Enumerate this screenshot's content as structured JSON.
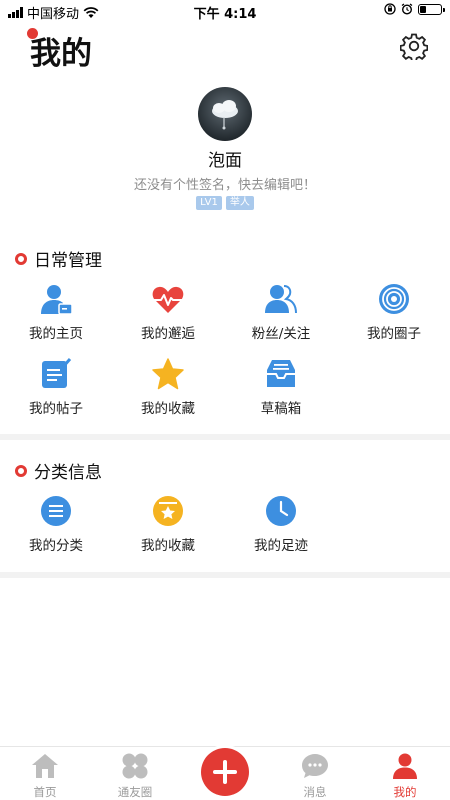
{
  "status_bar": {
    "carrier": "中国移动",
    "time": "下午 4:14"
  },
  "header": {
    "title": "我的"
  },
  "profile": {
    "username": "泡面",
    "signature": "还没有个性签名，快去编辑吧！",
    "level_badge": "LV1",
    "role_badge": "举人"
  },
  "daily": {
    "title": "日常管理",
    "items": [
      {
        "label": "我的主页",
        "icon": "user-card-icon"
      },
      {
        "label": "我的邂逅",
        "icon": "heartbeat-icon"
      },
      {
        "label": "粉丝/关注",
        "icon": "users-icon"
      },
      {
        "label": "我的圈子",
        "icon": "target-icon"
      },
      {
        "label": "我的帖子",
        "icon": "edit-doc-icon"
      },
      {
        "label": "我的收藏",
        "icon": "star-icon"
      },
      {
        "label": "草稿箱",
        "icon": "inbox-tray-icon"
      }
    ]
  },
  "category": {
    "title": "分类信息",
    "items": [
      {
        "label": "我的分类",
        "icon": "list-circle-icon"
      },
      {
        "label": "我的收藏",
        "icon": "star-box-icon"
      },
      {
        "label": "我的足迹",
        "icon": "clock-icon"
      }
    ]
  },
  "tabbar": {
    "items": [
      {
        "label": "首页",
        "icon": "home-icon"
      },
      {
        "label": "通友圈",
        "icon": "clover-icon"
      },
      {
        "label": "消息",
        "icon": "message-icon"
      },
      {
        "label": "我的",
        "icon": "person-icon",
        "active": true
      }
    ]
  },
  "colors": {
    "accent": "#e23a34",
    "icon_blue": "#3d8fe0",
    "icon_red": "#e8443d",
    "icon_yellow": "#f5b321",
    "badge": "#a9c9ec"
  }
}
